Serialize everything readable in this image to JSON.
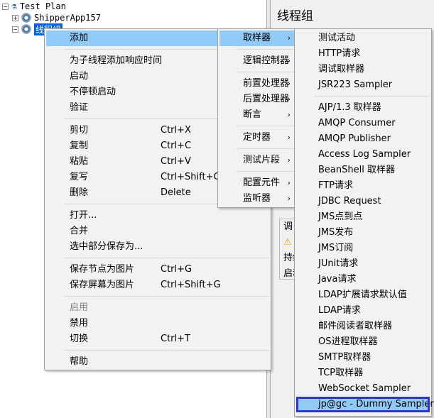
{
  "tree": {
    "root": "Test Plan",
    "child1": "ShipperApp157",
    "child2": "线程组"
  },
  "right": {
    "title": "线程组",
    "box_lines": [
      "调",
      "持续",
      "启动"
    ]
  },
  "menu": {
    "items": [
      {
        "label": "添加",
        "arrow": true,
        "hl": true
      },
      {
        "sep": true
      },
      {
        "label": "为子线程添加响应时间"
      },
      {
        "label": "启动"
      },
      {
        "label": "不停顿启动"
      },
      {
        "label": "验证"
      },
      {
        "sep": true
      },
      {
        "label": "剪切",
        "shortcut": "Ctrl+X"
      },
      {
        "label": "复制",
        "shortcut": "Ctrl+C"
      },
      {
        "label": "粘贴",
        "shortcut": "Ctrl+V"
      },
      {
        "label": "复写",
        "shortcut": "Ctrl+Shift+C"
      },
      {
        "label": "删除",
        "shortcut": "Delete"
      },
      {
        "sep": true
      },
      {
        "label": "打开..."
      },
      {
        "label": "合并"
      },
      {
        "label": "选中部分保存为..."
      },
      {
        "sep": true
      },
      {
        "label": "保存节点为图片",
        "shortcut": "Ctrl+G"
      },
      {
        "label": "保存屏幕为图片",
        "shortcut": "Ctrl+Shift+G"
      },
      {
        "sep": true
      },
      {
        "label": "启用",
        "disabled": true
      },
      {
        "label": "禁用"
      },
      {
        "label": "切换",
        "shortcut": "Ctrl+T"
      },
      {
        "sep": true
      },
      {
        "label": "帮助"
      }
    ]
  },
  "submenu": {
    "items": [
      {
        "label": "取样器",
        "arrow": true,
        "hl": true
      },
      {
        "sep": true
      },
      {
        "label": "逻辑控制器",
        "arrow": true
      },
      {
        "sep": true
      },
      {
        "label": "前置处理器",
        "arrow": true
      },
      {
        "label": "后置处理器",
        "arrow": true
      },
      {
        "label": "断言",
        "arrow": true
      },
      {
        "sep": true
      },
      {
        "label": "定时器",
        "arrow": true
      },
      {
        "sep": true
      },
      {
        "label": "测试片段",
        "arrow": true
      },
      {
        "sep": true
      },
      {
        "label": "配置元件",
        "arrow": true
      },
      {
        "label": "监听器",
        "arrow": true
      }
    ]
  },
  "samplers": {
    "items": [
      {
        "label": "测试活动"
      },
      {
        "label": "HTTP请求"
      },
      {
        "label": "调试取样器"
      },
      {
        "label": "JSR223 Sampler"
      },
      {
        "sep": true
      },
      {
        "label": "AJP/1.3 取样器"
      },
      {
        "label": "AMQP Consumer"
      },
      {
        "label": "AMQP Publisher"
      },
      {
        "label": "Access Log Sampler"
      },
      {
        "label": "BeanShell 取样器"
      },
      {
        "label": "FTP请求"
      },
      {
        "label": "JDBC Request"
      },
      {
        "label": "JMS点到点"
      },
      {
        "label": "JMS发布"
      },
      {
        "label": "JMS订阅"
      },
      {
        "label": "JUnit请求"
      },
      {
        "label": "Java请求"
      },
      {
        "label": "LDAP扩展请求默认值"
      },
      {
        "label": "LDAP请求"
      },
      {
        "label": "邮件阅读者取样器"
      },
      {
        "label": "OS进程取样器"
      },
      {
        "label": "SMTP取样器"
      },
      {
        "label": "TCP取样器"
      },
      {
        "label": "WebSocket Sampler"
      },
      {
        "label": "jp@gc - Dummy Sampler",
        "hl": true,
        "boxed": true
      }
    ]
  },
  "colors": {
    "highlight": "#91c9f7",
    "selection_box": "#3333cc"
  }
}
